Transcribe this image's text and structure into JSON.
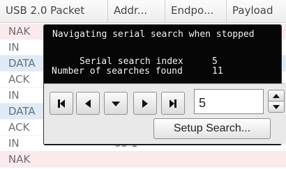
{
  "table": {
    "columns": [
      "USB 2.0 Packet",
      "Addr...",
      "Endpo...",
      "Payload"
    ],
    "rows": [
      {
        "label": "NAK",
        "extra": ""
      },
      {
        "label": "IN",
        "extra": ""
      },
      {
        "label": "DATA",
        "extra": ""
      },
      {
        "label": "ACK",
        "extra": ""
      },
      {
        "label": "IN",
        "extra": ""
      },
      {
        "label": "DATA",
        "extra": ""
      },
      {
        "label": "ACK",
        "extra": ""
      },
      {
        "label": "IN",
        "extra": "05           1"
      },
      {
        "label": "NAK",
        "extra": ""
      }
    ]
  },
  "popup": {
    "title": "Navigating serial search when stopped",
    "search_index_label": "Serial search index",
    "search_index_value": "5",
    "searches_found_label": "Number of searches found",
    "searches_found_value": "11"
  },
  "controls": {
    "first_icon": "skip-to-first-icon",
    "previous_icon": "previous-arrow-icon",
    "down_icon": "down-arrow-icon",
    "next_icon": "next-arrow-icon",
    "last_icon": "skip-to-last-icon",
    "index_input_value": "5",
    "setup_search_label": "Setup Search..."
  },
  "colors": {
    "row_nak": "#fbe9ec",
    "row_data": "#dfeaf8",
    "popup_bg": "#060606",
    "popup_text": "#f2f2f2",
    "controls_bg": "#e9e9e9"
  }
}
